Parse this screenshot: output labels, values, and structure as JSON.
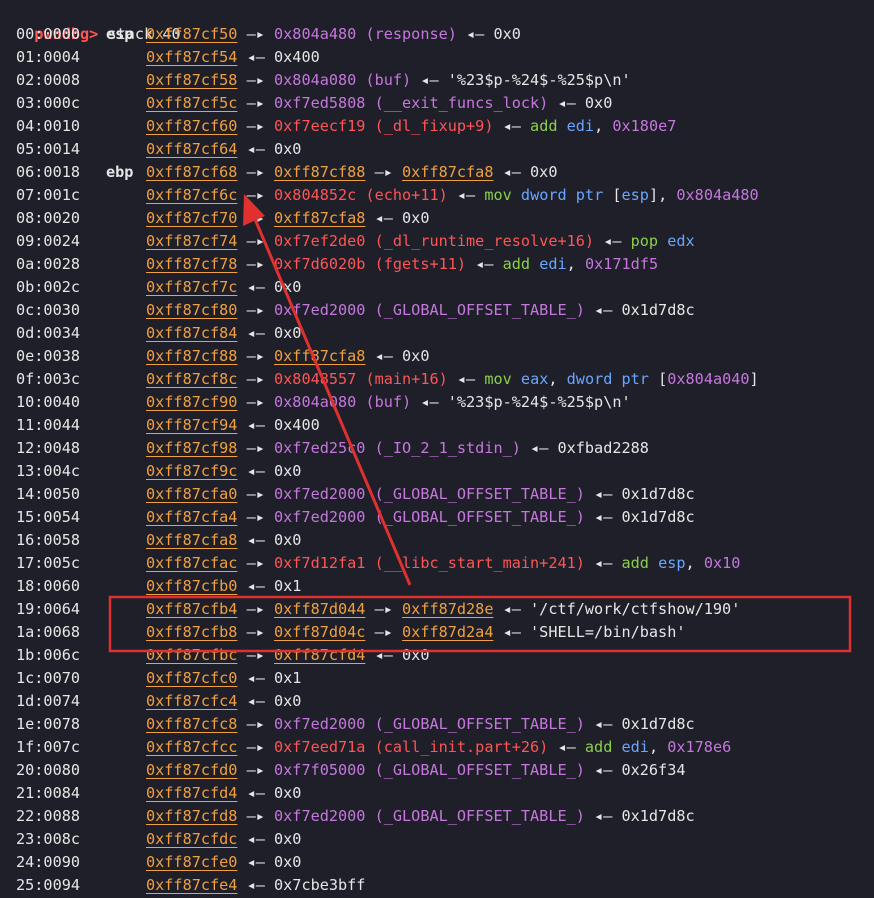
{
  "prompt": {
    "name": "pwndbg>",
    "command": " stack 40"
  },
  "colors": {
    "background": "#1e1f29",
    "pointer": "#f0a040",
    "code": "#ff5555",
    "data": "#c677dd",
    "instruction": "#8ad04a",
    "register": "#6aa6ff",
    "annotation": "#e03030"
  },
  "rows": [
    {
      "idx": "00:0000",
      "reg": "esp",
      "segs": [
        {
          "t": "0xff87cf50",
          "c": "ptr"
        },
        {
          "t": " —▸ ",
          "c": "plain"
        },
        {
          "t": "0x804a480 (response)",
          "c": "data"
        },
        {
          "t": " ◂— 0x0",
          "c": "plain"
        }
      ]
    },
    {
      "idx": "01:0004",
      "reg": "",
      "segs": [
        {
          "t": "0xff87cf54",
          "c": "ptr"
        },
        {
          "t": " ◂— 0x400",
          "c": "plain"
        }
      ]
    },
    {
      "idx": "02:0008",
      "reg": "",
      "segs": [
        {
          "t": "0xff87cf58",
          "c": "ptr"
        },
        {
          "t": " —▸ ",
          "c": "plain"
        },
        {
          "t": "0x804a080 (buf)",
          "c": "data"
        },
        {
          "t": " ◂— '%23$p-%24$-%25$p\\n'",
          "c": "plain"
        }
      ]
    },
    {
      "idx": "03:000c",
      "reg": "",
      "segs": [
        {
          "t": "0xff87cf5c",
          "c": "ptr"
        },
        {
          "t": " —▸ ",
          "c": "plain"
        },
        {
          "t": "0xf7ed5808 (__exit_funcs_lock)",
          "c": "data"
        },
        {
          "t": " ◂— 0x0",
          "c": "plain"
        }
      ]
    },
    {
      "idx": "04:0010",
      "reg": "",
      "segs": [
        {
          "t": "0xff87cf60",
          "c": "ptr"
        },
        {
          "t": " —▸ ",
          "c": "plain"
        },
        {
          "t": "0xf7eecf19 (_dl_fixup+9)",
          "c": "code"
        },
        {
          "t": " ◂— ",
          "c": "plain"
        },
        {
          "t": "add",
          "c": "ins"
        },
        {
          "t": " ",
          "c": "plain"
        },
        {
          "t": "edi",
          "c": "reg"
        },
        {
          "t": ", ",
          "c": "plain"
        },
        {
          "t": "0x180e7",
          "c": "imm"
        }
      ]
    },
    {
      "idx": "05:0014",
      "reg": "",
      "segs": [
        {
          "t": "0xff87cf64",
          "c": "ptr"
        },
        {
          "t": " ◂— 0x0",
          "c": "plain"
        }
      ]
    },
    {
      "idx": "06:0018",
      "reg": "ebp",
      "segs": [
        {
          "t": "0xff87cf68",
          "c": "ptr"
        },
        {
          "t": " —▸ ",
          "c": "plain"
        },
        {
          "t": "0xff87cf88",
          "c": "ptr"
        },
        {
          "t": " —▸ ",
          "c": "plain"
        },
        {
          "t": "0xff87cfa8",
          "c": "ptr"
        },
        {
          "t": " ◂— 0x0",
          "c": "plain"
        }
      ]
    },
    {
      "idx": "07:001c",
      "reg": "",
      "segs": [
        {
          "t": "0xff87cf6c",
          "c": "ptr"
        },
        {
          "t": " —▸ ",
          "c": "plain"
        },
        {
          "t": "0x804852c (echo+11)",
          "c": "code"
        },
        {
          "t": " ◂— ",
          "c": "plain"
        },
        {
          "t": "mov",
          "c": "ins"
        },
        {
          "t": " ",
          "c": "plain"
        },
        {
          "t": "dword ptr",
          "c": "reg"
        },
        {
          "t": " [",
          "c": "plain"
        },
        {
          "t": "esp",
          "c": "reg"
        },
        {
          "t": "], ",
          "c": "plain"
        },
        {
          "t": "0x804a480",
          "c": "imm"
        }
      ]
    },
    {
      "idx": "08:0020",
      "reg": "",
      "segs": [
        {
          "t": "0xff87cf70",
          "c": "ptr"
        },
        {
          "t": " —▸ ",
          "c": "plain"
        },
        {
          "t": "0xff87cfa8",
          "c": "ptr"
        },
        {
          "t": " ◂— 0x0",
          "c": "plain"
        }
      ]
    },
    {
      "idx": "09:0024",
      "reg": "",
      "segs": [
        {
          "t": "0xff87cf74",
          "c": "ptr"
        },
        {
          "t": " —▸ ",
          "c": "plain"
        },
        {
          "t": "0xf7ef2de0 (_dl_runtime_resolve+16)",
          "c": "code"
        },
        {
          "t": " ◂— ",
          "c": "plain"
        },
        {
          "t": "pop",
          "c": "ins"
        },
        {
          "t": " ",
          "c": "plain"
        },
        {
          "t": "edx",
          "c": "reg"
        }
      ]
    },
    {
      "idx": "0a:0028",
      "reg": "",
      "segs": [
        {
          "t": "0xff87cf78",
          "c": "ptr"
        },
        {
          "t": " —▸ ",
          "c": "plain"
        },
        {
          "t": "0xf7d6020b (fgets+11)",
          "c": "code"
        },
        {
          "t": " ◂— ",
          "c": "plain"
        },
        {
          "t": "add",
          "c": "ins"
        },
        {
          "t": " ",
          "c": "plain"
        },
        {
          "t": "edi",
          "c": "reg"
        },
        {
          "t": ", ",
          "c": "plain"
        },
        {
          "t": "0x171df5",
          "c": "imm"
        }
      ]
    },
    {
      "idx": "0b:002c",
      "reg": "",
      "segs": [
        {
          "t": "0xff87cf7c",
          "c": "ptr"
        },
        {
          "t": " ◂— 0x0",
          "c": "plain"
        }
      ]
    },
    {
      "idx": "0c:0030",
      "reg": "",
      "segs": [
        {
          "t": "0xff87cf80",
          "c": "ptr"
        },
        {
          "t": " —▸ ",
          "c": "plain"
        },
        {
          "t": "0xf7ed2000 (_GLOBAL_OFFSET_TABLE_)",
          "c": "data"
        },
        {
          "t": " ◂— 0x1d7d8c",
          "c": "plain"
        }
      ]
    },
    {
      "idx": "0d:0034",
      "reg": "",
      "segs": [
        {
          "t": "0xff87cf84",
          "c": "ptr"
        },
        {
          "t": " ◂— 0x0",
          "c": "plain"
        }
      ]
    },
    {
      "idx": "0e:0038",
      "reg": "",
      "segs": [
        {
          "t": "0xff87cf88",
          "c": "ptr"
        },
        {
          "t": " —▸ ",
          "c": "plain"
        },
        {
          "t": "0xff87cfa8",
          "c": "ptr"
        },
        {
          "t": " ◂— 0x0",
          "c": "plain"
        }
      ]
    },
    {
      "idx": "0f:003c",
      "reg": "",
      "segs": [
        {
          "t": "0xff87cf8c",
          "c": "ptr"
        },
        {
          "t": " —▸ ",
          "c": "plain"
        },
        {
          "t": "0x8048557 (main+16)",
          "c": "code"
        },
        {
          "t": " ◂— ",
          "c": "plain"
        },
        {
          "t": "mov",
          "c": "ins"
        },
        {
          "t": " ",
          "c": "plain"
        },
        {
          "t": "eax",
          "c": "reg"
        },
        {
          "t": ", ",
          "c": "plain"
        },
        {
          "t": "dword ptr",
          "c": "reg"
        },
        {
          "t": " [",
          "c": "plain"
        },
        {
          "t": "0x804a040",
          "c": "imm"
        },
        {
          "t": "]",
          "c": "plain"
        }
      ]
    },
    {
      "idx": "10:0040",
      "reg": "",
      "segs": [
        {
          "t": "0xff87cf90",
          "c": "ptr"
        },
        {
          "t": " —▸ ",
          "c": "plain"
        },
        {
          "t": "0x804a080 (buf)",
          "c": "data"
        },
        {
          "t": " ◂— '%23$p-%24$-%25$p\\n'",
          "c": "plain"
        }
      ]
    },
    {
      "idx": "11:0044",
      "reg": "",
      "segs": [
        {
          "t": "0xff87cf94",
          "c": "ptr"
        },
        {
          "t": " ◂— 0x400",
          "c": "plain"
        }
      ]
    },
    {
      "idx": "12:0048",
      "reg": "",
      "segs": [
        {
          "t": "0xff87cf98",
          "c": "ptr"
        },
        {
          "t": " —▸ ",
          "c": "plain"
        },
        {
          "t": "0xf7ed25c0 (_IO_2_1_stdin_)",
          "c": "data"
        },
        {
          "t": " ◂— 0xfbad2288",
          "c": "plain"
        }
      ]
    },
    {
      "idx": "13:004c",
      "reg": "",
      "segs": [
        {
          "t": "0xff87cf9c",
          "c": "ptr"
        },
        {
          "t": " ◂— 0x0",
          "c": "plain"
        }
      ]
    },
    {
      "idx": "14:0050",
      "reg": "",
      "segs": [
        {
          "t": "0xff87cfa0",
          "c": "ptr"
        },
        {
          "t": " —▸ ",
          "c": "plain"
        },
        {
          "t": "0xf7ed2000 (_GLOBAL_OFFSET_TABLE_)",
          "c": "data"
        },
        {
          "t": " ◂— 0x1d7d8c",
          "c": "plain"
        }
      ]
    },
    {
      "idx": "15:0054",
      "reg": "",
      "segs": [
        {
          "t": "0xff87cfa4",
          "c": "ptr"
        },
        {
          "t": " —▸ ",
          "c": "plain"
        },
        {
          "t": "0xf7ed2000 (_GLOBAL_OFFSET_TABLE_)",
          "c": "data"
        },
        {
          "t": " ◂— 0x1d7d8c",
          "c": "plain"
        }
      ]
    },
    {
      "idx": "16:0058",
      "reg": "",
      "segs": [
        {
          "t": "0xff87cfa8",
          "c": "ptr"
        },
        {
          "t": " ◂— 0x0",
          "c": "plain"
        }
      ]
    },
    {
      "idx": "17:005c",
      "reg": "",
      "segs": [
        {
          "t": "0xff87cfac",
          "c": "ptr"
        },
        {
          "t": " —▸ ",
          "c": "plain"
        },
        {
          "t": "0xf7d12fa1 (__libc_start_main+241)",
          "c": "code"
        },
        {
          "t": " ◂— ",
          "c": "plain"
        },
        {
          "t": "add",
          "c": "ins"
        },
        {
          "t": " ",
          "c": "plain"
        },
        {
          "t": "esp",
          "c": "reg"
        },
        {
          "t": ", ",
          "c": "plain"
        },
        {
          "t": "0x10",
          "c": "imm"
        }
      ]
    },
    {
      "idx": "18:0060",
      "reg": "",
      "segs": [
        {
          "t": "0xff87cfb0",
          "c": "ptr"
        },
        {
          "t": " ◂— 0x1",
          "c": "plain"
        }
      ]
    },
    {
      "idx": "19:0064",
      "reg": "",
      "segs": [
        {
          "t": "0xff87cfb4",
          "c": "ptr"
        },
        {
          "t": " —▸ ",
          "c": "plain"
        },
        {
          "t": "0xff87d044",
          "c": "ptr"
        },
        {
          "t": " —▸ ",
          "c": "plain"
        },
        {
          "t": "0xff87d28e",
          "c": "ptr"
        },
        {
          "t": " ◂— '/ctf/work/ctfshow/190'",
          "c": "plain"
        }
      ]
    },
    {
      "idx": "1a:0068",
      "reg": "",
      "segs": [
        {
          "t": "0xff87cfb8",
          "c": "ptr"
        },
        {
          "t": " —▸ ",
          "c": "plain"
        },
        {
          "t": "0xff87d04c",
          "c": "ptr"
        },
        {
          "t": " —▸ ",
          "c": "plain"
        },
        {
          "t": "0xff87d2a4",
          "c": "ptr"
        },
        {
          "t": " ◂— 'SHELL=/bin/bash'",
          "c": "plain"
        }
      ]
    },
    {
      "idx": "1b:006c",
      "reg": "",
      "segs": [
        {
          "t": "0xff87cfbc",
          "c": "ptr"
        },
        {
          "t": " —▸ ",
          "c": "plain"
        },
        {
          "t": "0xff87cfd4",
          "c": "ptr"
        },
        {
          "t": " ◂— 0x0",
          "c": "plain"
        }
      ]
    },
    {
      "idx": "1c:0070",
      "reg": "",
      "segs": [
        {
          "t": "0xff87cfc0",
          "c": "ptr"
        },
        {
          "t": " ◂— 0x1",
          "c": "plain"
        }
      ]
    },
    {
      "idx": "1d:0074",
      "reg": "",
      "segs": [
        {
          "t": "0xff87cfc4",
          "c": "ptr"
        },
        {
          "t": " ◂— 0x0",
          "c": "plain"
        }
      ]
    },
    {
      "idx": "1e:0078",
      "reg": "",
      "segs": [
        {
          "t": "0xff87cfc8",
          "c": "ptr"
        },
        {
          "t": " —▸ ",
          "c": "plain"
        },
        {
          "t": "0xf7ed2000 (_GLOBAL_OFFSET_TABLE_)",
          "c": "data"
        },
        {
          "t": " ◂— 0x1d7d8c",
          "c": "plain"
        }
      ]
    },
    {
      "idx": "1f:007c",
      "reg": "",
      "segs": [
        {
          "t": "0xff87cfcc",
          "c": "ptr"
        },
        {
          "t": " —▸ ",
          "c": "plain"
        },
        {
          "t": "0xf7eed71a (call_init.part+26)",
          "c": "code"
        },
        {
          "t": " ◂— ",
          "c": "plain"
        },
        {
          "t": "add",
          "c": "ins"
        },
        {
          "t": " ",
          "c": "plain"
        },
        {
          "t": "edi",
          "c": "reg"
        },
        {
          "t": ", ",
          "c": "plain"
        },
        {
          "t": "0x178e6",
          "c": "imm"
        }
      ]
    },
    {
      "idx": "20:0080",
      "reg": "",
      "segs": [
        {
          "t": "0xff87cfd0",
          "c": "ptr"
        },
        {
          "t": " —▸ ",
          "c": "plain"
        },
        {
          "t": "0xf7f05000 (_GLOBAL_OFFSET_TABLE_)",
          "c": "data"
        },
        {
          "t": " ◂— 0x26f34",
          "c": "plain"
        }
      ]
    },
    {
      "idx": "21:0084",
      "reg": "",
      "segs": [
        {
          "t": "0xff87cfd4",
          "c": "ptr"
        },
        {
          "t": " ◂— 0x0",
          "c": "plain"
        }
      ]
    },
    {
      "idx": "22:0088",
      "reg": "",
      "segs": [
        {
          "t": "0xff87cfd8",
          "c": "ptr"
        },
        {
          "t": " —▸ ",
          "c": "plain"
        },
        {
          "t": "0xf7ed2000 (_GLOBAL_OFFSET_TABLE_)",
          "c": "data"
        },
        {
          "t": " ◂— 0x1d7d8c",
          "c": "plain"
        }
      ]
    },
    {
      "idx": "23:008c",
      "reg": "",
      "segs": [
        {
          "t": "0xff87cfdc",
          "c": "ptr"
        },
        {
          "t": " ◂— 0x0",
          "c": "plain"
        }
      ]
    },
    {
      "idx": "24:0090",
      "reg": "",
      "segs": [
        {
          "t": "0xff87cfe0",
          "c": "ptr"
        },
        {
          "t": " ◂— 0x0",
          "c": "plain"
        }
      ]
    },
    {
      "idx": "25:0094",
      "reg": "",
      "segs": [
        {
          "t": "0xff87cfe4",
          "c": "ptr"
        },
        {
          "t": " ◂— 0x7cbe3bff",
          "c": "plain"
        }
      ]
    }
  ]
}
